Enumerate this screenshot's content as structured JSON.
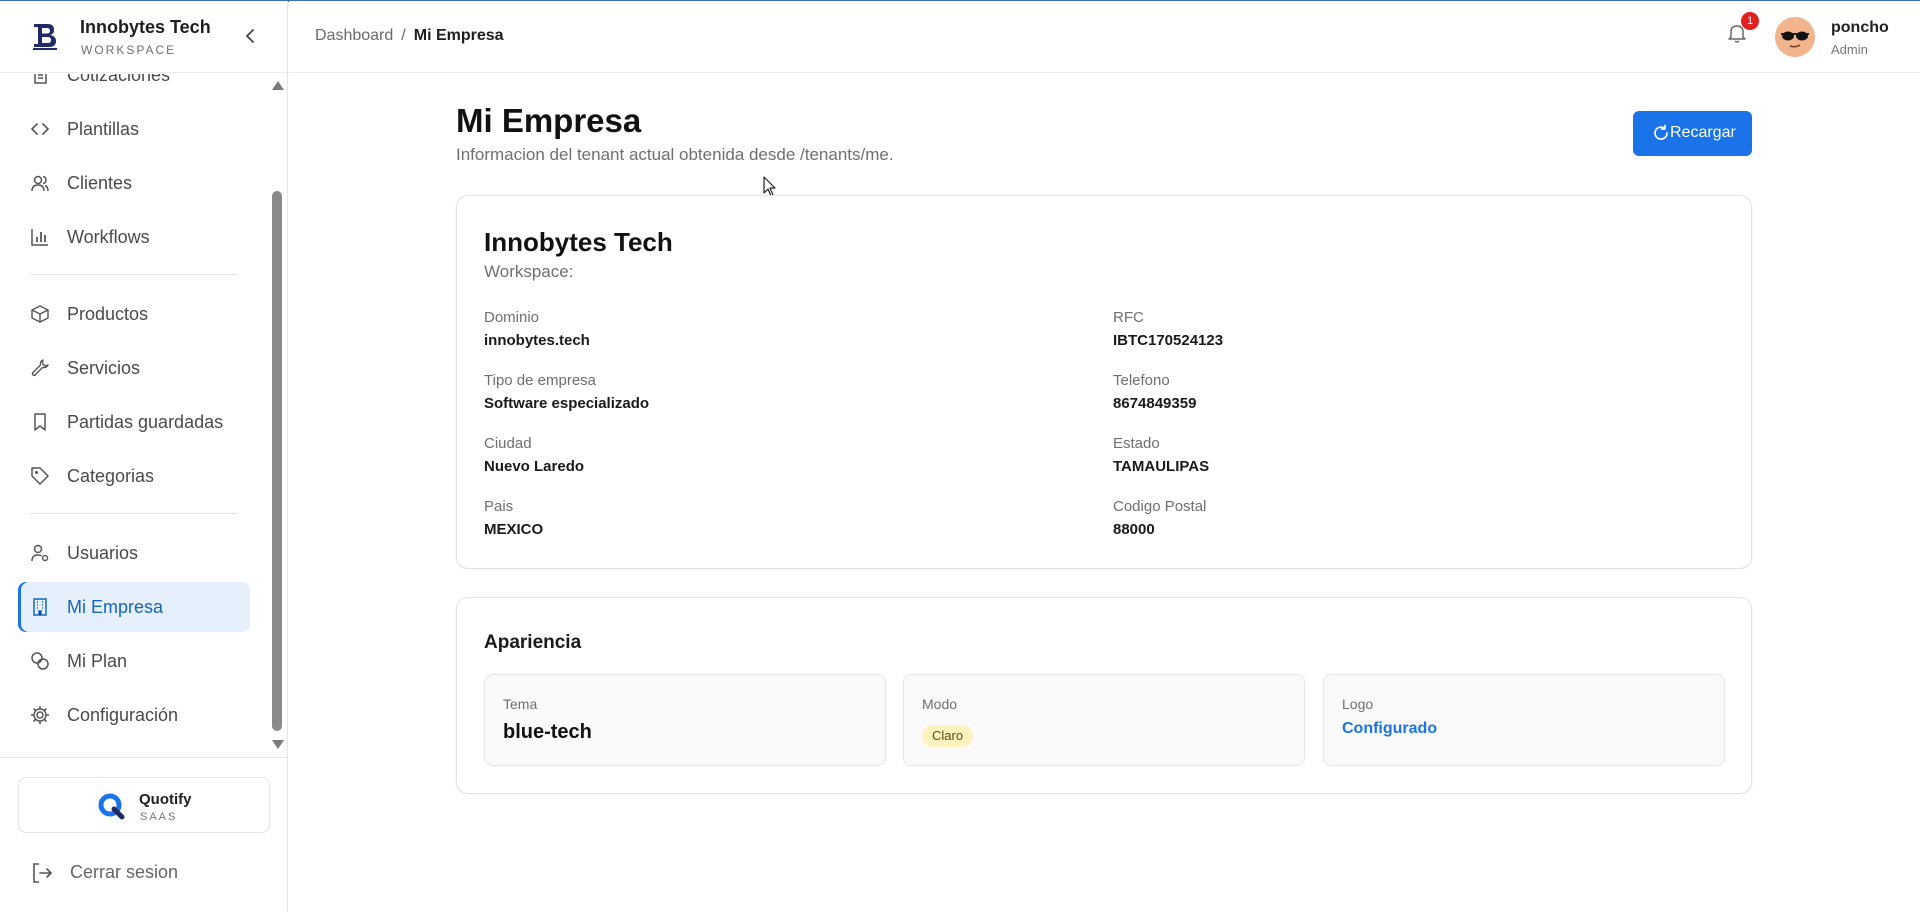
{
  "brand": {
    "name": "Innobytes Tech",
    "sub": "WORKSPACE"
  },
  "sidebar": {
    "items": [
      {
        "label": "Cotizaciones",
        "icon": "file-text-icon"
      },
      {
        "label": "Plantillas",
        "icon": "code-icon"
      },
      {
        "label": "Clientes",
        "icon": "users-icon"
      },
      {
        "label": "Workflows",
        "icon": "bar-chart-icon"
      },
      {
        "label": "Productos",
        "icon": "package-icon"
      },
      {
        "label": "Servicios",
        "icon": "wrench-icon"
      },
      {
        "label": "Partidas guardadas",
        "icon": "bookmark-icon"
      },
      {
        "label": "Categorias",
        "icon": "tag-icon"
      },
      {
        "label": "Usuarios",
        "icon": "user-cog-icon"
      },
      {
        "label": "Mi Empresa",
        "icon": "building-icon",
        "active": true
      },
      {
        "label": "Mi Plan",
        "icon": "coins-icon"
      },
      {
        "label": "Configuración",
        "icon": "gear-icon"
      }
    ],
    "product": {
      "name": "Quotify",
      "sub": "SAAS"
    },
    "logout_label": "Cerrar sesion"
  },
  "header": {
    "breadcrumb": {
      "parent": "Dashboard",
      "separator": "/",
      "current": "Mi Empresa"
    },
    "notifications_count": "1",
    "user": {
      "name": "poncho",
      "role": "Admin"
    }
  },
  "main": {
    "title": "Mi Empresa",
    "subtitle": "Informacion del tenant actual obtenida desde /tenants/me.",
    "reload_label": "Recargar",
    "company": {
      "name": "Innobytes Tech",
      "workspace": "Workspace:",
      "fields": [
        {
          "label": "Dominio",
          "value": "innobytes.tech"
        },
        {
          "label": "RFC",
          "value": "IBTC170524123"
        },
        {
          "label": "Tipo de empresa",
          "value": "Software especializado"
        },
        {
          "label": "Telefono",
          "value": "8674849359"
        },
        {
          "label": "Ciudad",
          "value": "Nuevo Laredo"
        },
        {
          "label": "Estado",
          "value": "TAMAULIPAS"
        },
        {
          "label": "Pais",
          "value": "MEXICO"
        },
        {
          "label": "Codigo Postal",
          "value": "88000"
        }
      ]
    },
    "appearance": {
      "title": "Apariencia",
      "tema": {
        "label": "Tema",
        "value": "blue-tech"
      },
      "modo": {
        "label": "Modo",
        "value": "Claro"
      },
      "logo": {
        "label": "Logo",
        "value": "Configurado"
      }
    }
  },
  "colors": {
    "accent": "#1a73e8",
    "active_bg": "#e5f0fc",
    "badge_red": "#e02020",
    "mode_badge": "#fdf3bf"
  }
}
